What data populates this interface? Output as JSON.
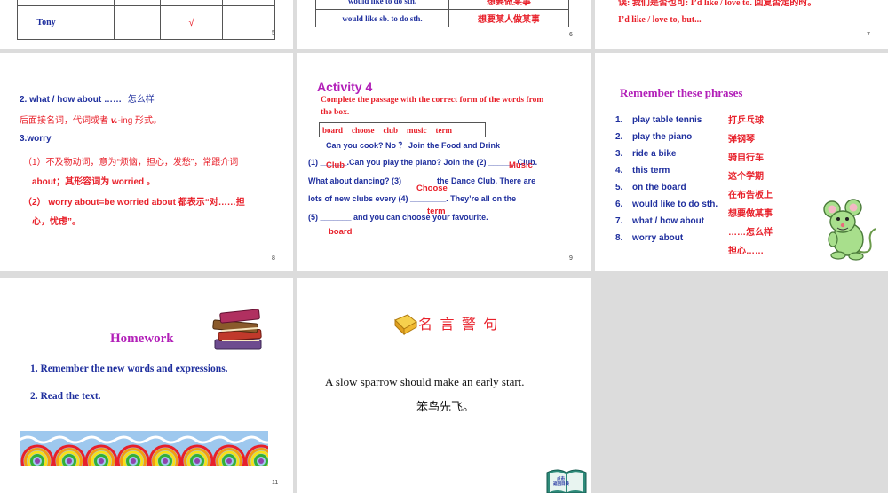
{
  "slide5": {
    "row_name": "Tony",
    "check": "√",
    "page": "5"
  },
  "slide6": {
    "rows": [
      {
        "en": "would like to do sth.",
        "cn": "想要做某事"
      },
      {
        "en": "would like sb. to do sth.",
        "cn": "想要某人做某事"
      }
    ],
    "page": "6"
  },
  "slide7": {
    "line1": "误: 我们是否也可: I’d like / love to. 回复否定的时。",
    "line2": "I’d like / love to, but...",
    "page": "7"
  },
  "slide8": {
    "line1_en": "2. what / how about ……",
    "line1_cn": "怎么样",
    "line2": "后面接名词，代词或者",
    "line2_v": "v.",
    "line2_ing": "-ing 形式。",
    "line3": "3.worry",
    "line4": "（1）不及物动词，意为“烦恼，担心，发愁”，常跟介词",
    "line5": "about；其形容词为 worried 。",
    "line6": "（2） worry about=be worried about 都表示“对……担",
    "line7": "心，忧虑”。",
    "page": "8"
  },
  "slide9": {
    "title": "Activity 4",
    "instruction1": "Complete the passage with the correct form of the words from",
    "instruction2": "the box.",
    "box_words": [
      "board",
      "choose",
      "club",
      "music",
      "term"
    ],
    "sentence0": "Can you cook? No ？ Join the Food and Drink",
    "p1a": "(1) ",
    "p1_blank": "______",
    "p1b": ".Can you play the piano? Join the (2) ",
    "p1_blank2": "______",
    "p1c": " Club.",
    "p2a": "What about dancing? (3) ",
    "p2_blank": "_______",
    "p2b": " the Dance Club. There are",
    "p3a": "lots of new clubs every (4) ",
    "p3_blank": "________",
    "p3b": ". They’re all on the",
    "p4a": "(5) ",
    "p4_blank": "_______",
    "p4b": " and you can choose your favourite.",
    "ans1": "Club",
    "ans2": "Music",
    "ans3": "Choose",
    "ans4": "term",
    "ans5": "board",
    "page": "9"
  },
  "slide10": {
    "title": "Remember these phrases",
    "en": [
      "play table tennis",
      "play the piano",
      "ride a bike",
      "this term",
      "on the board",
      "would like to do sth.",
      "what / how about",
      "worry about"
    ],
    "nums": [
      "1.",
      "2.",
      "3.",
      "4.",
      "5.",
      "6.",
      "7.",
      "8."
    ],
    "cn": [
      "打乒乓球",
      "弹钢琴",
      "骑自行车",
      "这个学期",
      "在布告板上",
      "想要做某事",
      "……怎么样",
      "担心……"
    ]
  },
  "slide11": {
    "title": "Homework",
    "item1": "1. Remember the new words and expressions.",
    "item2": "2. Read the text.",
    "page": "11"
  },
  "slide12": {
    "title": "名 言 警 句",
    "quote_en": "A slow sparrow should make an early start.",
    "quote_cn": "笨鸟先飞。",
    "book_label1": "点击",
    "book_label2": "返回目录"
  },
  "colors": {
    "red": "#e8202a",
    "blue": "#1f2f9e",
    "purple": "#b21fb8"
  }
}
